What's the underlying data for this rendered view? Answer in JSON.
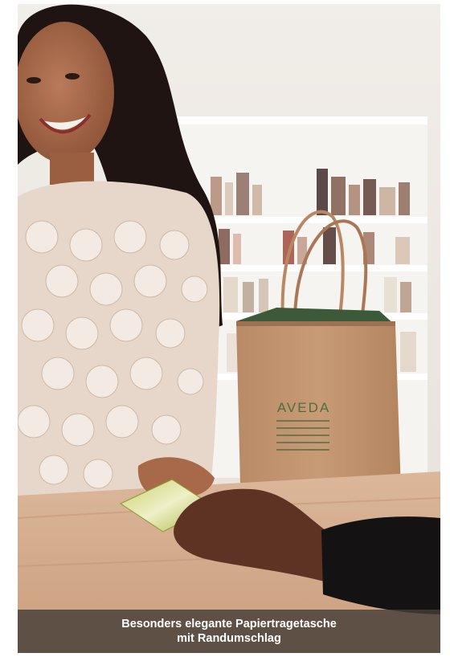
{
  "photo": {
    "bag_brand": "AVEDA"
  },
  "caption": {
    "line1": "Besonders elegante Papiertragetasche",
    "line2": "mit Randumschlag"
  }
}
